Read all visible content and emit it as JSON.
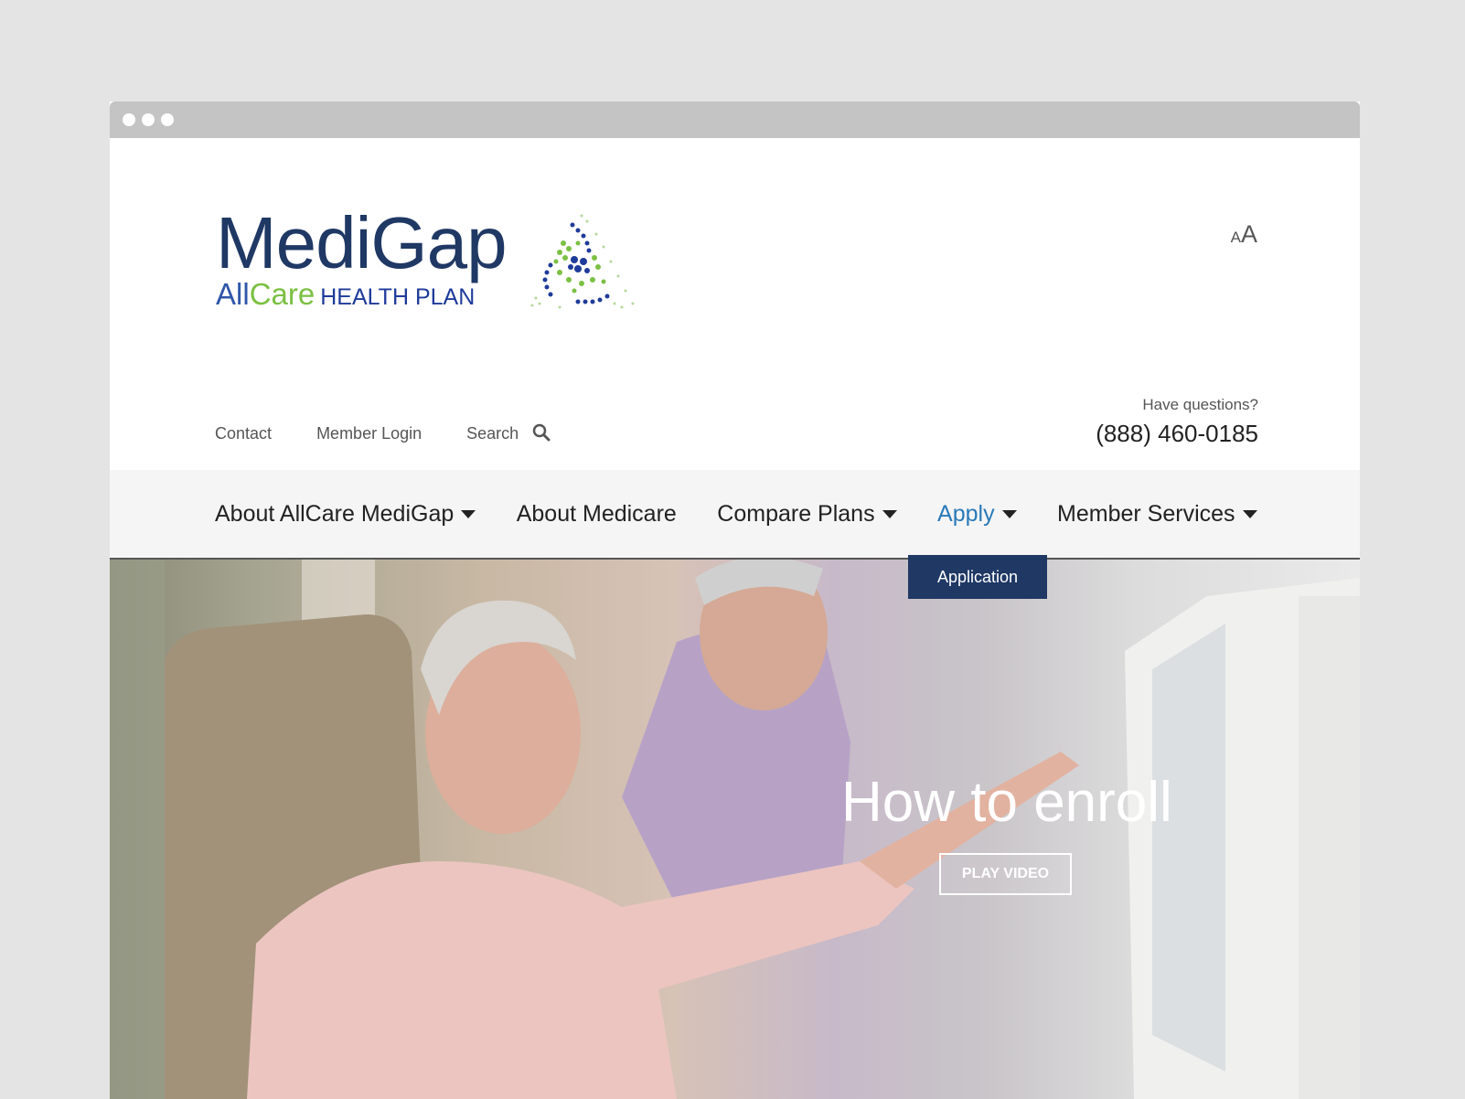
{
  "brand": {
    "logo_main": "MediGap",
    "logo_all": "All",
    "logo_care": "Care",
    "logo_plan": "HEALTH PLAN",
    "colors": {
      "navy": "#1f3864",
      "blue": "#2f56a9",
      "green": "#7bc043",
      "link": "#2a7ab8"
    }
  },
  "textsize": {
    "small": "A",
    "big": "A"
  },
  "utility": {
    "contact": "Contact",
    "member_login": "Member Login",
    "search": "Search",
    "search_icon": "search-icon"
  },
  "contact_box": {
    "question": "Have questions?",
    "phone": "(888) 460-0185"
  },
  "nav": {
    "items": [
      {
        "label": "About AllCare MediGap",
        "dropdown": true
      },
      {
        "label": "About Medicare",
        "dropdown": false
      },
      {
        "label": "Compare Plans",
        "dropdown": true
      },
      {
        "label": "Apply",
        "dropdown": true,
        "active": true
      },
      {
        "label": "Member Services",
        "dropdown": true
      }
    ],
    "apply_submenu": [
      "Application"
    ]
  },
  "hero": {
    "title": "How to enroll",
    "button": "PLAY VIDEO"
  }
}
